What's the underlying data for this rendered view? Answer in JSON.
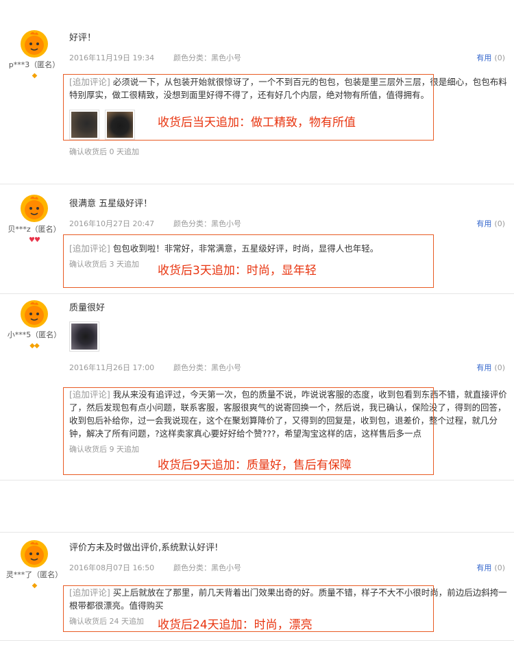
{
  "reviews": [
    {
      "username": "p***3（匿名）",
      "rank": "◆",
      "text": "好评！",
      "date": "2016年11月19日 19:34",
      "color_class": "颜色分类：黑色小号",
      "useful_label": "有用",
      "useful_count": "(0)",
      "append_tag": "[追加评论]",
      "append_text": "必须说一下，从包装开始就很惊讶了，一个不到百元的包包，包装是里三层外三层，很是细心，包包布料特别厚实，做工很精致，没想到面里好得不得了，还有好几个内层，绝对物有所值，值得拥有。",
      "append_note": "确认收货后 0 天追加",
      "highlight": "收货后当天追加：做工精致，物有所值"
    },
    {
      "username": "贝***z（匿名）",
      "rank": "♥♥",
      "text": "很满意 五星级好评！",
      "date": "2016年10月27日 20:47",
      "color_class": "颜色分类：黑色小号",
      "useful_label": "有用",
      "useful_count": "(0)",
      "append_tag": "[追加评论]",
      "append_text": "包包收到啦！非常好，非常满意，五星级好评，时尚，显得人也年轻。",
      "append_note": "确认收货后 3 天追加",
      "highlight": "收货后3天追加：时尚，显年轻"
    },
    {
      "username": "小***5（匿名）",
      "rank": "◆◆",
      "text": "质量很好",
      "date": "2016年11月26日 17:00",
      "color_class": "颜色分类：黑色小号",
      "useful_label": "有用",
      "useful_count": "(0)",
      "append_tag": "[追加评论]",
      "append_text": "我从来没有追评过，今天第一次，包的质量不说，咋说说客服的态度，收到包看到东西不错，就直接评价了，然后发现包有点小问题，联系客服，客服很爽气的说寄回换一个，然后说，我已确认，保险没了，得到的回答，收到包后补给你，过一会我说现在，这个在聚划算降价了，又得到的回复是，收到包，退差价，整个过程，就几分钟，解决了所有问题，?这样卖家真心要好好给个赞???，希望淘宝这样的店，这样售后多一点",
      "append_note": "确认收货后 9 天追加",
      "highlight": "收货后9天追加：质量好，售后有保障"
    },
    {
      "username": "灵***了（匿名）",
      "rank": "◆",
      "text": "评价方未及时做出评价,系统默认好评!",
      "date": "2016年08月07日 16:50",
      "color_class": "颜色分类：黑色小号",
      "useful_label": "有用",
      "useful_count": "(0)",
      "append_tag": "[追加评论]",
      "append_text": "买上后就放在了那里，前几天背着出门效果出奇的好。质量不错，样子不大不小很时尚，前边后边斜挎一根带都很漂亮。值得购买",
      "append_note": "确认收货后 24 天追加",
      "highlight": "收货后24天追加：时尚，漂亮"
    }
  ],
  "icons": {
    "avatar": "orange-mascot-avatar-icon",
    "rank": "diamond-rank-icon",
    "heart_rank": "heart-rank-icon"
  },
  "colors": {
    "highlight": "#e8340f",
    "box": "#e85a22",
    "link": "#3366cc",
    "avatar_bg": "#ffb400"
  }
}
